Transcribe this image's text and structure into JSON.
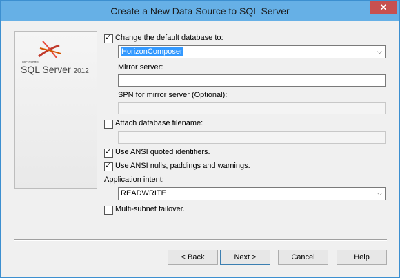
{
  "window": {
    "title": "Create a New Data Source to SQL Server",
    "close_glyph": "✕"
  },
  "logo": {
    "microsoft": "Microsoft®",
    "product": "SQL Server",
    "version": "2012"
  },
  "form": {
    "change_db": {
      "label": "Change the default database to:",
      "checked": true
    },
    "database_value": "HorizonComposer",
    "mirror_label": "Mirror server:",
    "mirror_value": "",
    "spn_label": "SPN for mirror server (Optional):",
    "spn_value": "",
    "attach": {
      "label": "Attach database filename:",
      "checked": false
    },
    "attach_value": "",
    "ansi_quoted": {
      "label": "Use ANSI quoted identifiers.",
      "checked": true
    },
    "ansi_nulls": {
      "label": "Use ANSI nulls, paddings and warnings.",
      "checked": true
    },
    "app_intent_label": "Application intent:",
    "app_intent_value": "READWRITE",
    "multisubnet": {
      "label": "Multi-subnet failover.",
      "checked": false
    }
  },
  "buttons": {
    "back": "< Back",
    "next": "Next >",
    "cancel": "Cancel",
    "help": "Help"
  },
  "glyphs": {
    "check": "✓",
    "dropdown": "⌵"
  }
}
